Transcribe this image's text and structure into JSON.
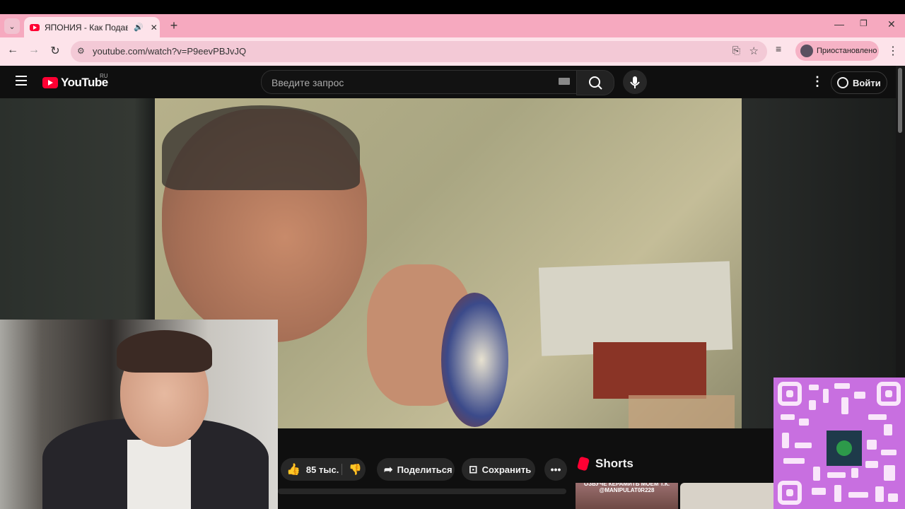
{
  "browser": {
    "tab_title": "ЯПОНИЯ - Как Подавить Н",
    "url": "youtube.com/watch?v=P9eevPBJvJQ",
    "profile_label": "Приостановлено",
    "icons": {
      "tab_search": "chevron-down-icon",
      "audio": "speaker-icon",
      "close": "close-icon",
      "new_tab": "plus-icon",
      "back": "arrow-left-icon",
      "forward": "arrow-right-icon",
      "reload": "reload-icon",
      "site_info": "tune-icon",
      "install": "install-app-icon",
      "bookmark": "star-icon",
      "media": "media-controls-icon",
      "menu": "kebab-icon"
    }
  },
  "youtube": {
    "logo_text": "YouTube",
    "country_code": "RU",
    "search_placeholder": "Введите запрос",
    "login_label": "Войти",
    "likes": "85 тыс.",
    "share_label": "Поделиться",
    "save_label": "Сохранить",
    "shorts_label": "Shorts",
    "shorts_thumb_caption": "ОЗВУЧЕ КЕРАМИТЬ МОЕМ Т.К. @MANIPULAT0R228",
    "brand_color": "#ff0033"
  },
  "theme": {
    "tab_strip": "#f6a9bf",
    "toolbar": "#fde3ea",
    "yt_background": "#0f0f0f"
  }
}
